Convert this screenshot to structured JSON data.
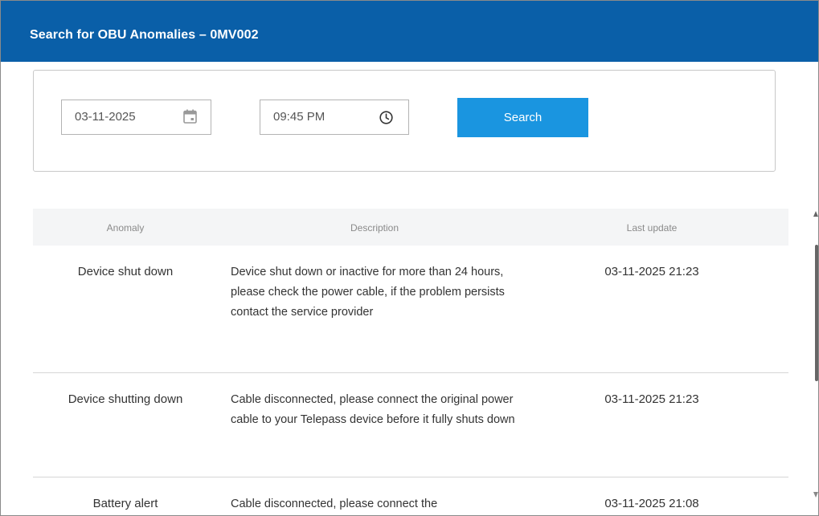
{
  "header": {
    "title": "Search for OBU Anomalies – 0MV002"
  },
  "filters": {
    "date_value": "03-11-2025",
    "time_value": "09:45 PM",
    "search_label": "Search"
  },
  "table": {
    "columns": [
      "Anomaly",
      "Description",
      "Last update"
    ],
    "rows": [
      {
        "anomaly": "Device shut down",
        "description": "Device shut down or inactive for more than 24 hours, please check the power cable, if the problem persists contact the service provider",
        "last_update": "03-11-2025 21:23"
      },
      {
        "anomaly": "Device shutting down",
        "description": "Cable disconnected, please connect the original power cable to your Telepass device before it fully shuts down",
        "last_update": "03-11-2025 21:23"
      },
      {
        "anomaly": "Battery alert",
        "description": "Cable disconnected, please connect the",
        "last_update": "03-11-2025 21:08"
      }
    ]
  },
  "colors": {
    "header_bg": "#0a5fa8",
    "button_bg": "#1a95e0"
  }
}
